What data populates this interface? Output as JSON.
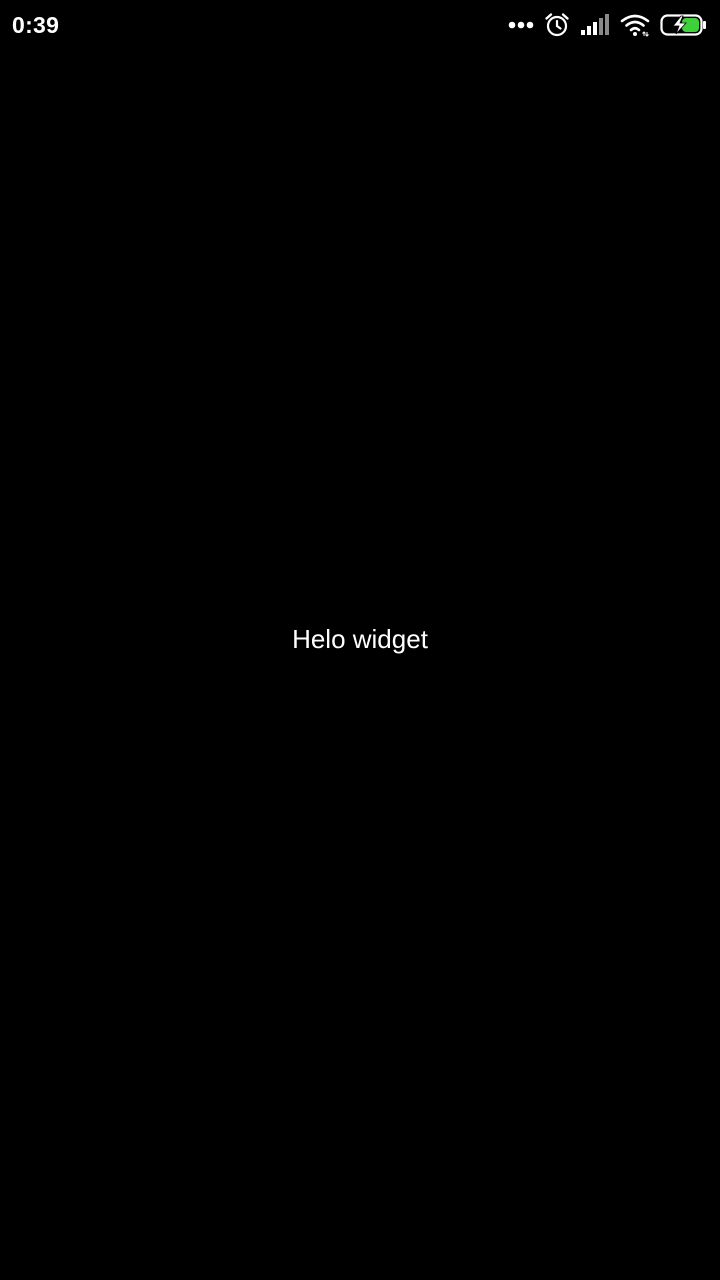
{
  "status_bar": {
    "time": "0:39",
    "icons": [
      "more-dots-icon",
      "alarm-icon",
      "signal-icon",
      "wifi-icon",
      "battery-charging-icon"
    ],
    "battery_accent_color": "#3fd13b"
  },
  "main": {
    "text": "Helo widget"
  },
  "colors": {
    "background": "#000000",
    "foreground": "#ffffff"
  }
}
